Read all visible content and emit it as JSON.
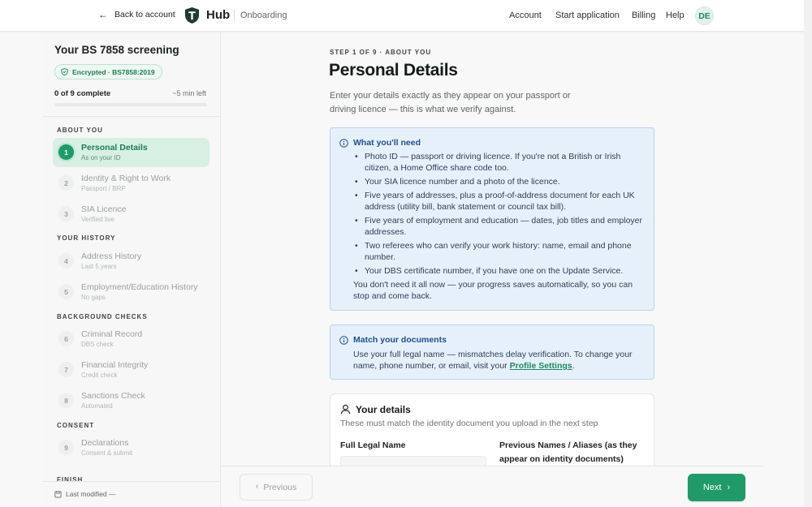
{
  "header": {
    "back_label": "Back to account",
    "brand": "Hub",
    "section": "Onboarding",
    "nav": [
      "Account",
      "Start application",
      "Billing",
      "Help"
    ],
    "avatar_initials": "DE"
  },
  "sidebar": {
    "title": "Your BS 7858 screening",
    "badge": "Encrypted · BS7858:2019",
    "progress_label": "0 of 9 complete",
    "progress_fraction": 0,
    "time_left": "~5 min left",
    "groups": [
      "ABOUT YOU",
      "YOUR HISTORY",
      "BACKGROUND CHECKS",
      "CONSENT",
      "FINISH"
    ],
    "steps": [
      {
        "num": "1",
        "title": "Personal Details",
        "sub": "As on your ID"
      },
      {
        "num": "2",
        "title": "Identity & Right to Work",
        "sub": "Passport / BRP"
      },
      {
        "num": "3",
        "title": "SIA Licence",
        "sub": "Verified live"
      },
      {
        "num": "4",
        "title": "Address History",
        "sub": "Last 5 years"
      },
      {
        "num": "5",
        "title": "Employment/Education History",
        "sub": "No gaps"
      },
      {
        "num": "6",
        "title": "Criminal Record",
        "sub": "DBS check"
      },
      {
        "num": "7",
        "title": "Financial Integrity",
        "sub": "Credit check"
      },
      {
        "num": "8",
        "title": "Sanctions Check",
        "sub": "Automated"
      },
      {
        "num": "9",
        "title": "Declarations",
        "sub": "Consent & submit"
      }
    ],
    "last_modified": "Last modified —"
  },
  "main": {
    "eyebrow": "STEP 1 OF 9 · ABOUT YOU",
    "title": "Personal Details",
    "intro": "Enter your details exactly as they appear on your passport or driving licence — this is what we verify against.",
    "need": {
      "title": "What you'll need",
      "items": [
        "Photo ID — passport or driving licence. If you're not a British or Irish citizen, a Home Office share code too.",
        "Your SIA licence number and a photo of the licence.",
        "Five years of addresses, plus a proof-of-address document for each UK address (utility bill, bank statement or council tax bill).",
        "Five years of employment and education — dates, job titles and employer addresses.",
        "Two referees who can verify your work history: name, email and phone number.",
        "Your DBS certificate number, if you have one on the Update Service."
      ],
      "footer": "You don't need it all now — your progress saves automatically, so you can stop and come back."
    },
    "docs": {
      "title": "Match your documents",
      "text": "Use your full legal name — mismatches delay verification. To change your name, phone number, or email, visit your ",
      "link": "Profile Settings",
      "end": "."
    },
    "card": {
      "title": "Your details",
      "subtitle": "These must match the identity document you upload in the next step",
      "field1_label": "Full Legal Name",
      "field2_label": "Previous Names / Aliases (as they appear on identity documents)"
    }
  },
  "footer": {
    "prev_label": "Previous",
    "next_label": "Next"
  },
  "colors": {
    "accent": "#1f9a68",
    "info_bg": "#e6f0fb",
    "info_title": "#1d4f8c"
  }
}
